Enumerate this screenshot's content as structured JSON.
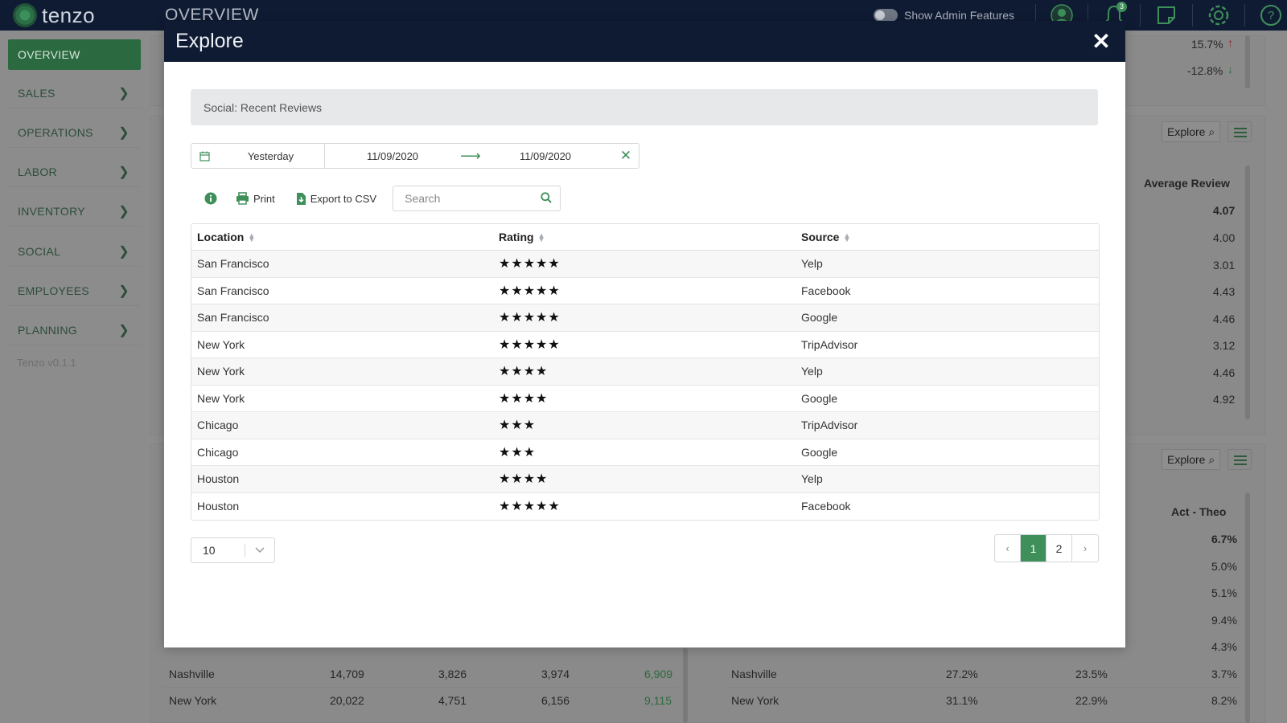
{
  "topbar": {
    "logo_text": "tenzo",
    "page_title": "OVERVIEW",
    "admin_toggle_label": "Show Admin Features",
    "notification_count": "3",
    "icons": [
      "user-icon",
      "bell-icon",
      "note-icon",
      "settings-icon",
      "help-icon"
    ]
  },
  "sidebar": {
    "items": [
      {
        "label": "OVERVIEW"
      },
      {
        "label": "SALES"
      },
      {
        "label": "OPERATIONS"
      },
      {
        "label": "LABOR"
      },
      {
        "label": "INVENTORY"
      },
      {
        "label": "SOCIAL"
      },
      {
        "label": "EMPLOYEES"
      },
      {
        "label": "PLANNING"
      }
    ],
    "version": "Tenzo v0.1.1"
  },
  "background": {
    "top_right_values": [
      "15.7%",
      "-12.8%"
    ],
    "explore_label": "Explore",
    "panel1_header": "Average Review",
    "panel1_values": [
      "4.07",
      "4.00",
      "3.01",
      "4.43",
      "4.46",
      "3.12",
      "4.46",
      "4.92"
    ],
    "panel2_header": "Act - Theo",
    "panel2_values": [
      "6.7%",
      "5.0%",
      "5.1%",
      "9.4%",
      "4.3%",
      "3.7%",
      "8.2%"
    ],
    "bottom_left_rows": [
      {
        "location": "Nashville",
        "a": "14,709",
        "b": "3,826",
        "c": "3,974",
        "d": "6,909"
      },
      {
        "location": "New York",
        "a": "20,022",
        "b": "4,751",
        "c": "6,156",
        "d": "9,115"
      }
    ],
    "bottom_right_rows": [
      {
        "location": "Nashville",
        "a": "27.2%",
        "b": "23.5%"
      },
      {
        "location": "New York",
        "a": "31.1%",
        "b": "22.9%"
      }
    ]
  },
  "modal": {
    "title": "Explore",
    "close_symbol": "✕",
    "subtitle": "Social: Recent Reviews",
    "date_range": {
      "preset": "Yesterday",
      "start": "11/09/2020",
      "end": "11/09/2020"
    },
    "toolbar": {
      "print_label": "Print",
      "export_label": "Export to CSV",
      "search_placeholder": "Search"
    },
    "table": {
      "headers": [
        "Location",
        "Rating",
        "Source"
      ],
      "rows": [
        {
          "location": "San Francisco",
          "rating": "★★★★★",
          "source": "Yelp"
        },
        {
          "location": "San Francisco",
          "rating": "★★★★★",
          "source": "Facebook"
        },
        {
          "location": "San Francisco",
          "rating": "★★★★★",
          "source": "Google"
        },
        {
          "location": "New York",
          "rating": "★★★★★",
          "source": "TripAdvisor"
        },
        {
          "location": "New York",
          "rating": "★★★★",
          "source": "Yelp"
        },
        {
          "location": "New York",
          "rating": "★★★★",
          "source": "Google"
        },
        {
          "location": "Chicago",
          "rating": "★★★",
          "source": "TripAdvisor"
        },
        {
          "location": "Chicago",
          "rating": "★★★",
          "source": "Google"
        },
        {
          "location": "Houston",
          "rating": "★★★★",
          "source": "Yelp"
        },
        {
          "location": "Houston",
          "rating": "★★★★★",
          "source": "Facebook"
        }
      ]
    },
    "page_size": "10",
    "pagination": {
      "prev": "‹",
      "pages": [
        "1",
        "2"
      ],
      "current": "1",
      "next": "›"
    }
  },
  "colors": {
    "accent": "#3f8f5a",
    "header_bg": "#0f1b33"
  }
}
